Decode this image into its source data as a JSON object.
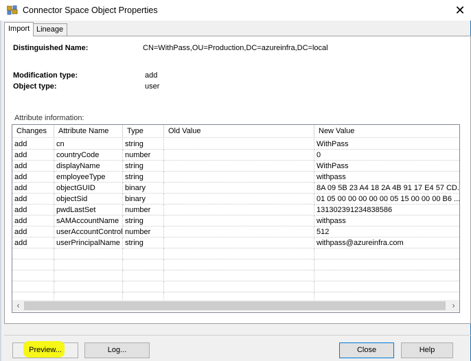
{
  "window": {
    "title": "Connector Space Object Properties",
    "close_glyph": "✕"
  },
  "tabs": [
    {
      "label": "Import",
      "active": true
    },
    {
      "label": "Lineage",
      "active": false
    }
  ],
  "object": {
    "dn_label": "Distinguished Name:",
    "dn_value": "CN=WithPass,OU=Production,DC=azureinfra,DC=local",
    "mod_type_label": "Modification type:",
    "mod_type_value": "add",
    "obj_type_label": "Object type:",
    "obj_type_value": "user"
  },
  "attributes": {
    "caption": "Attribute information:",
    "columns": [
      "Changes",
      "Attribute Name",
      "Type",
      "Old Value",
      "New Value"
    ],
    "rows": [
      [
        "add",
        "cn",
        "string",
        "",
        "WithPass"
      ],
      [
        "add",
        "countryCode",
        "number",
        "",
        "0"
      ],
      [
        "add",
        "displayName",
        "string",
        "",
        "WithPass"
      ],
      [
        "add",
        "employeeType",
        "string",
        "",
        "withpass"
      ],
      [
        "add",
        "objectGUID",
        "binary",
        "",
        "8A 09 5B 23 A4 18 2A 4B 91 17 E4 57 CD..."
      ],
      [
        "add",
        "objectSid",
        "binary",
        "",
        "01 05 00 00 00 00 00 05 15 00 00 00 B6 ..."
      ],
      [
        "add",
        "pwdLastSet",
        "number",
        "",
        "131302391234838586"
      ],
      [
        "add",
        "sAMAccountName",
        "string",
        "",
        "withpass"
      ],
      [
        "add",
        "userAccountControl",
        "number",
        "",
        "512"
      ],
      [
        "add",
        "userPrincipalName",
        "string",
        "",
        "withpass@azureinfra.com"
      ]
    ],
    "empty_rows": 6
  },
  "buttons": {
    "preview": "Preview...",
    "log": "Log...",
    "close": "Close",
    "help": "Help"
  },
  "colors": {
    "highlight": "#f6f716",
    "window_border": "#1f6fb3"
  }
}
